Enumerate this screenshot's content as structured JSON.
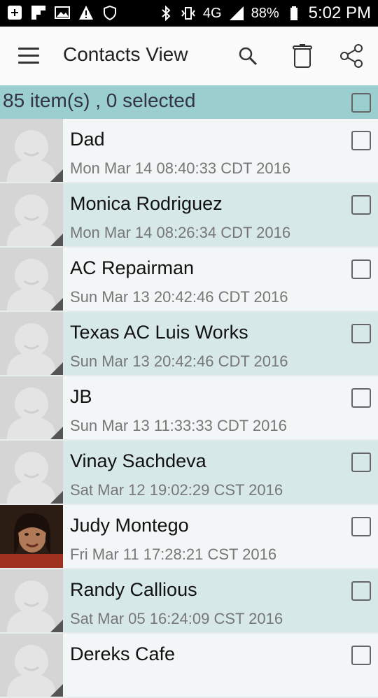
{
  "status_bar": {
    "battery": "88%",
    "time": "5:02 PM",
    "network": "4G"
  },
  "app_bar": {
    "title": "Contacts View",
    "icons": [
      "menu-icon",
      "search-icon",
      "trash-icon",
      "share-icon"
    ]
  },
  "summary": {
    "text": "85 item(s) , 0 selected"
  },
  "contacts": [
    {
      "name": "Dad",
      "date": "Mon Mar 14 08:40:33 CDT 2016",
      "photo": false
    },
    {
      "name": "Monica Rodriguez",
      "date": "Mon Mar 14 08:26:34 CDT 2016",
      "photo": false
    },
    {
      "name": "AC Repairman",
      "date": "Sun Mar 13 20:42:46 CDT 2016",
      "photo": false
    },
    {
      "name": "Texas AC Luis Works",
      "date": "Sun Mar 13 20:42:46 CDT 2016",
      "photo": false
    },
    {
      "name": "JB",
      "date": "Sun Mar 13 11:33:33 CDT 2016",
      "photo": false
    },
    {
      "name": "Vinay Sachdeva",
      "date": "Sat Mar 12 19:02:29 CST 2016",
      "photo": false
    },
    {
      "name": "Judy Montego",
      "date": "Fri Mar 11 17:28:21 CST 2016",
      "photo": true
    },
    {
      "name": "Randy Callious",
      "date": "Sat Mar 05 16:24:09 CST 2016",
      "photo": false
    },
    {
      "name": "Dereks Cafe",
      "date": "",
      "photo": false
    }
  ],
  "colors": {
    "summary_bg": "#9bcfcf",
    "row_even_bg": "#d6e9e8",
    "row_odd_bg": "#f2f6f6"
  }
}
